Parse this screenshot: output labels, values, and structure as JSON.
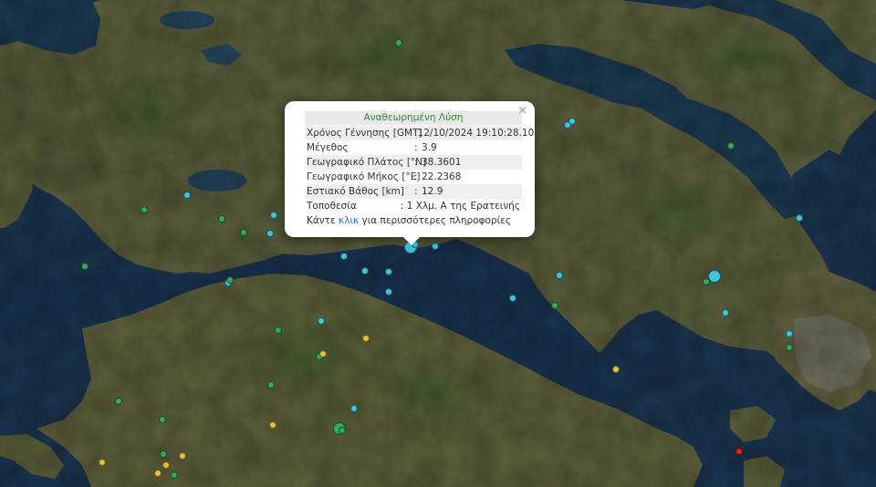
{
  "popup": {
    "title": "Αναθεωρημένη Λύση",
    "close_symbol": "×",
    "rows": [
      {
        "label": "Χρόνος Γέννησης [GMT]",
        "value": "12/10/2024 19:10:28.10"
      },
      {
        "label": "Μέγεθος",
        "value": "3.9"
      },
      {
        "label": "Γεωγραφικό Πλάτος [°N]",
        "value": "38.3601"
      },
      {
        "label": "Γεωγραφικό Μήκος [°E]",
        "value": "22.2368"
      },
      {
        "label": "Εστιακό Βάθος [km]",
        "value": "12.9"
      },
      {
        "label": "Τοποθεσία",
        "value": "1 Χλμ. Α της Ερατεινής"
      }
    ],
    "separator": ":",
    "more_prefix": "Κάντε",
    "more_link": "κλικ",
    "more_suffix": "για περισσότερες πληροφορίες"
  },
  "colors": {
    "title_green": "#2e8b2e",
    "link_blue": "#2a74c9",
    "marker_cyan": "#3fc6dd",
    "marker_green": "#35a85a",
    "marker_yellow": "#e2c13d",
    "marker_red": "#e0201b",
    "sea": "#1d3650",
    "land": "#5b5f3c"
  },
  "markers": [
    {
      "id": "selected-event",
      "color": "cyan",
      "size": "large",
      "selected": true
    },
    {
      "color": "cyan"
    },
    {
      "color": "cyan"
    },
    {
      "color": "cyan"
    },
    {
      "color": "cyan"
    },
    {
      "color": "cyan"
    },
    {
      "color": "cyan"
    },
    {
      "color": "cyan"
    },
    {
      "color": "cyan"
    },
    {
      "color": "cyan"
    },
    {
      "color": "cyan"
    },
    {
      "color": "cyan"
    },
    {
      "color": "cyan"
    },
    {
      "color": "cyan"
    },
    {
      "color": "cyan"
    },
    {
      "color": "cyan"
    },
    {
      "color": "cyan"
    },
    {
      "color": "cyan"
    },
    {
      "color": "cyan"
    },
    {
      "color": "cyan",
      "size": "large"
    },
    {
      "color": "cyan"
    },
    {
      "color": "green"
    },
    {
      "color": "green"
    },
    {
      "color": "green"
    },
    {
      "color": "green"
    },
    {
      "color": "green"
    },
    {
      "color": "green"
    },
    {
      "color": "green"
    },
    {
      "color": "green"
    },
    {
      "color": "green"
    },
    {
      "color": "green"
    },
    {
      "color": "green"
    },
    {
      "color": "green"
    },
    {
      "color": "green",
      "size": "large"
    },
    {
      "color": "green"
    },
    {
      "color": "green"
    },
    {
      "color": "green"
    },
    {
      "color": "green"
    },
    {
      "color": "green"
    },
    {
      "color": "green"
    },
    {
      "color": "yellow"
    },
    {
      "color": "yellow"
    },
    {
      "color": "yellow"
    },
    {
      "color": "yellow"
    },
    {
      "color": "yellow"
    },
    {
      "color": "yellow"
    },
    {
      "color": "yellow"
    },
    {
      "color": "yellow"
    },
    {
      "color": "red"
    }
  ]
}
